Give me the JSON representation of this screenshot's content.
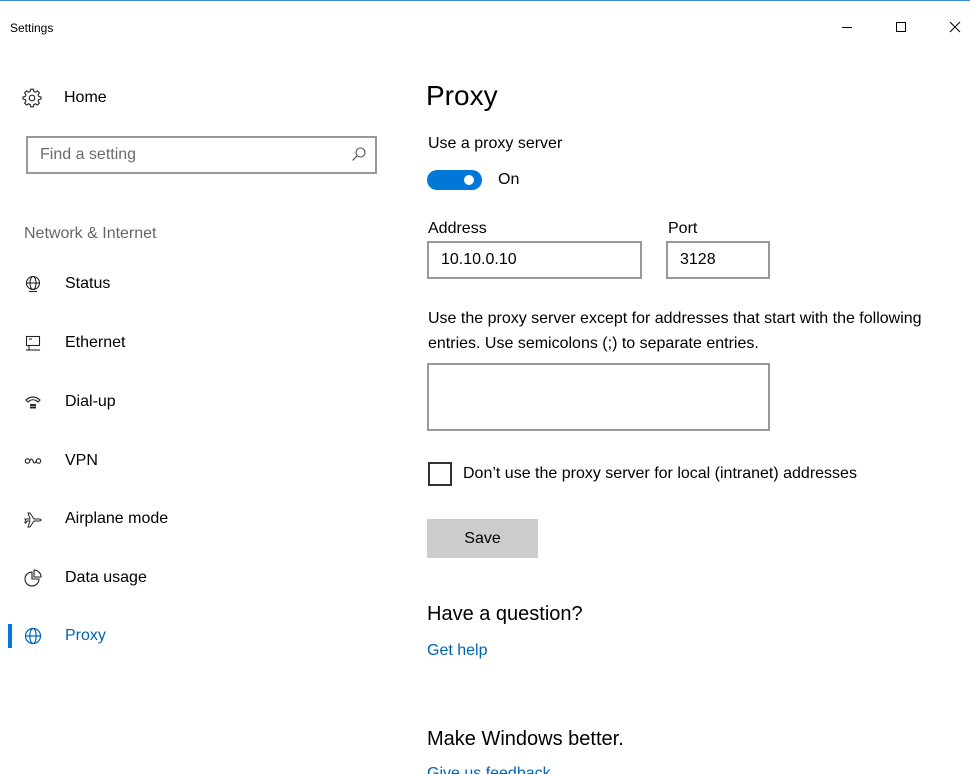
{
  "window": {
    "title": "Settings",
    "minimize_glyph": "—",
    "maximize_glyph": "☐",
    "close_glyph": "✕"
  },
  "sidebar": {
    "home_label": "Home",
    "search_placeholder": "Find a setting",
    "section_label": "Network & Internet",
    "items": [
      {
        "label": "Status",
        "icon": "globe-status-icon"
      },
      {
        "label": "Ethernet",
        "icon": "ethernet-icon"
      },
      {
        "label": "Dial-up",
        "icon": "dialup-icon"
      },
      {
        "label": "VPN",
        "icon": "vpn-icon"
      },
      {
        "label": "Airplane mode",
        "icon": "airplane-icon"
      },
      {
        "label": "Data usage",
        "icon": "data-usage-icon"
      },
      {
        "label": "Proxy",
        "icon": "globe-icon",
        "active": true
      }
    ]
  },
  "main": {
    "title": "Proxy",
    "use_proxy_label": "Use a proxy server",
    "toggle_state": "On",
    "address_label": "Address",
    "address_value": "10.10.0.10",
    "port_label": "Port",
    "port_value": "3128",
    "exceptions_text": "Use the proxy server except for addresses that start with the following entries. Use semicolons (;) to separate entries.",
    "exceptions_value": "",
    "bypass_local_label": "Don’t use the proxy server for local (intranet) addresses",
    "save_label": "Save",
    "question_heading": "Have a question?",
    "get_help_link": "Get help",
    "better_heading": "Make Windows better.",
    "feedback_link": "Give us feedback"
  },
  "colors": {
    "accent": "#0078d7",
    "link": "#0063b1",
    "border": "#999999",
    "button_bg": "#cccccc"
  }
}
